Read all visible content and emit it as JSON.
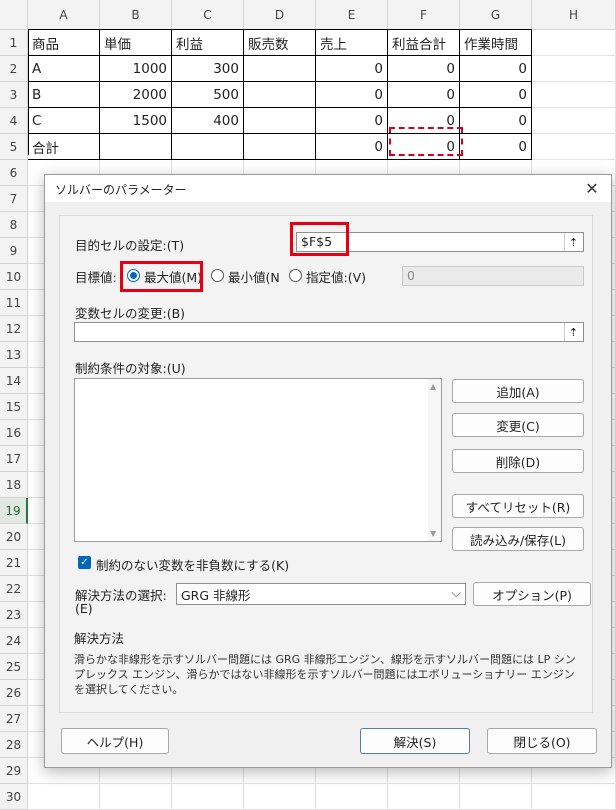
{
  "sheet": {
    "columns": [
      "A",
      "B",
      "C",
      "D",
      "E",
      "F",
      "G",
      "H"
    ],
    "rows": [
      "1",
      "2",
      "3",
      "4",
      "5",
      "6",
      "7",
      "8",
      "9",
      "10",
      "11",
      "12",
      "13",
      "14",
      "15",
      "16",
      "17",
      "18",
      "19",
      "20",
      "21",
      "22",
      "23",
      "24",
      "25",
      "26",
      "27",
      "28",
      "29",
      "30"
    ],
    "selected_row": "19",
    "headers": [
      "商品",
      "単価",
      "利益",
      "販売数",
      "売上",
      "利益合計",
      "作業時間"
    ],
    "data": [
      [
        "A",
        "1000",
        "300",
        "",
        "0",
        "0",
        "0"
      ],
      [
        "B",
        "2000",
        "500",
        "",
        "0",
        "0",
        "0"
      ],
      [
        "C",
        "1500",
        "400",
        "",
        "0",
        "0",
        "0"
      ],
      [
        "合計",
        "",
        "",
        "",
        "0",
        "0",
        "0"
      ]
    ]
  },
  "dialog": {
    "title": "ソルバーのパラメーター",
    "close_glyph": "✕",
    "objective_label": "目的セルの設定:(T)",
    "objective_value": "$F$5",
    "ref_glyph": "⇡",
    "target_label": "目標値:",
    "radio_max": "最大値(M)",
    "radio_min": "最小値(N",
    "radio_value": "指定値:(V)",
    "value_field": "0",
    "variables_label": "変数セルの変更:(B)",
    "variables_value": "",
    "constraints_label": "制約条件の対象:(U)",
    "scroll_up": "▲",
    "scroll_down": "▼",
    "btn_add": "追加(A)",
    "btn_change": "変更(C)",
    "btn_delete": "削除(D)",
    "btn_reset": "すべてリセット(R)",
    "btn_load": "読み込み/保存(L)",
    "nonneg_check_glyph": "✓",
    "nonneg_label": "制約のない変数を非負数にする(K)",
    "method_label_1": "解決方法の選択:",
    "method_label_2": "(E)",
    "method_value": "GRG 非線形",
    "dropdown_glyph": "⌵",
    "btn_options": "オプション(P)",
    "desc_title": "解決方法",
    "desc_text": "滑らかな非線形を示すソルバー問題には GRG 非線形エンジン、線形を示すソルバー問題には LP シンプレックス エンジン、滑らかではない非線形を示すソルバー問題にはエボリューショナリー エンジンを選択してください。",
    "btn_help": "ヘルプ(H)",
    "btn_solve": "解決(S)",
    "btn_close": "閉じる(O)"
  },
  "colors": {
    "highlight": "#e60012",
    "accent": "#0067c0",
    "grid_header": "#f3f3f3"
  }
}
